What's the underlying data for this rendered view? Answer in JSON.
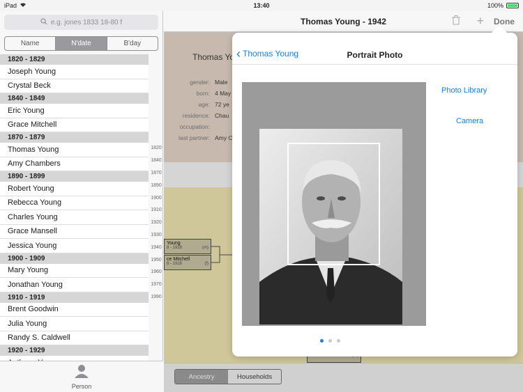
{
  "status_bar": {
    "device": "iPad",
    "time": "13:40",
    "battery": "100%",
    "battery_level": 1.0
  },
  "search": {
    "placeholder": "e.g. jones 1833 18-80 f"
  },
  "sort_tabs": [
    {
      "label": "Name",
      "selected": false
    },
    {
      "label": "N'date",
      "selected": true
    },
    {
      "label": "B'day",
      "selected": false
    }
  ],
  "person_list": [
    {
      "type": "header",
      "text": "1820 - 1829"
    },
    {
      "type": "item",
      "text": "Joseph Young"
    },
    {
      "type": "item",
      "text": "Crystal Beck"
    },
    {
      "type": "header",
      "text": "1840 - 1849"
    },
    {
      "type": "item",
      "text": "Eric Young"
    },
    {
      "type": "item",
      "text": "Grace Mitchell"
    },
    {
      "type": "header",
      "text": "1870 - 1879"
    },
    {
      "type": "item",
      "text": "Thomas Young"
    },
    {
      "type": "item",
      "text": "Amy Chambers"
    },
    {
      "type": "header",
      "text": "1890 - 1899"
    },
    {
      "type": "item",
      "text": "Robert Young"
    },
    {
      "type": "item",
      "text": "Rebecca Young"
    },
    {
      "type": "item",
      "text": "Charles Young"
    },
    {
      "type": "item",
      "text": "Grace Mansell"
    },
    {
      "type": "item",
      "text": "Jessica Young"
    },
    {
      "type": "header",
      "text": "1900 - 1909"
    },
    {
      "type": "item",
      "text": "Mary Young"
    },
    {
      "type": "item",
      "text": "Jonathan Young"
    },
    {
      "type": "header",
      "text": "1910 - 1919"
    },
    {
      "type": "item",
      "text": "Brent Goodwin"
    },
    {
      "type": "item",
      "text": "Julia Young"
    },
    {
      "type": "item",
      "text": "Randy S. Caldwell"
    },
    {
      "type": "header",
      "text": "1920 - 1929"
    },
    {
      "type": "item",
      "text": "Anthony Young"
    }
  ],
  "year_index": [
    "1820",
    "1840",
    "1870",
    "1890",
    "1900",
    "1910",
    "1920",
    "1930",
    "1940",
    "1950",
    "1960",
    "1970",
    "1990"
  ],
  "left_tab": {
    "label": "Person"
  },
  "nav": {
    "title": "Thomas Young - 1942",
    "done": "Done",
    "plus": "+"
  },
  "detail": {
    "name": "Thomas Yo",
    "fields": [
      {
        "label": "gender:",
        "value": "Male"
      },
      {
        "label": "born:",
        "value": "4 May"
      },
      {
        "label": "age:",
        "value": "72 ye"
      },
      {
        "label": "residence:",
        "value": "Chau"
      },
      {
        "label": "occupation:",
        "value": ""
      },
      {
        "label": "last partner:",
        "value": "Amy C"
      }
    ]
  },
  "tree": {
    "boxes": [
      {
        "name": "Young",
        "dates": "8 - 1928",
        "sex": "(m)"
      },
      {
        "name": "ce Mitchell",
        "dates": "8 - 1928",
        "sex": "(f)"
      },
      {
        "name": "",
        "dates": "1892 - 1972",
        "sex": "(m)"
      }
    ]
  },
  "bottom_tabs": [
    {
      "label": "Ancestry",
      "selected": true
    },
    {
      "label": "Households",
      "selected": false
    }
  ],
  "popover": {
    "back_label": "Thomas Young",
    "title": "Portrait Photo",
    "photo_library": "Photo Library",
    "camera": "Camera",
    "page_dots": 3,
    "active_dot": 0
  },
  "colors": {
    "accent": "#1a7de0",
    "detail_bg": "#c7b9ad",
    "tree_bg": "#cfc79a"
  }
}
